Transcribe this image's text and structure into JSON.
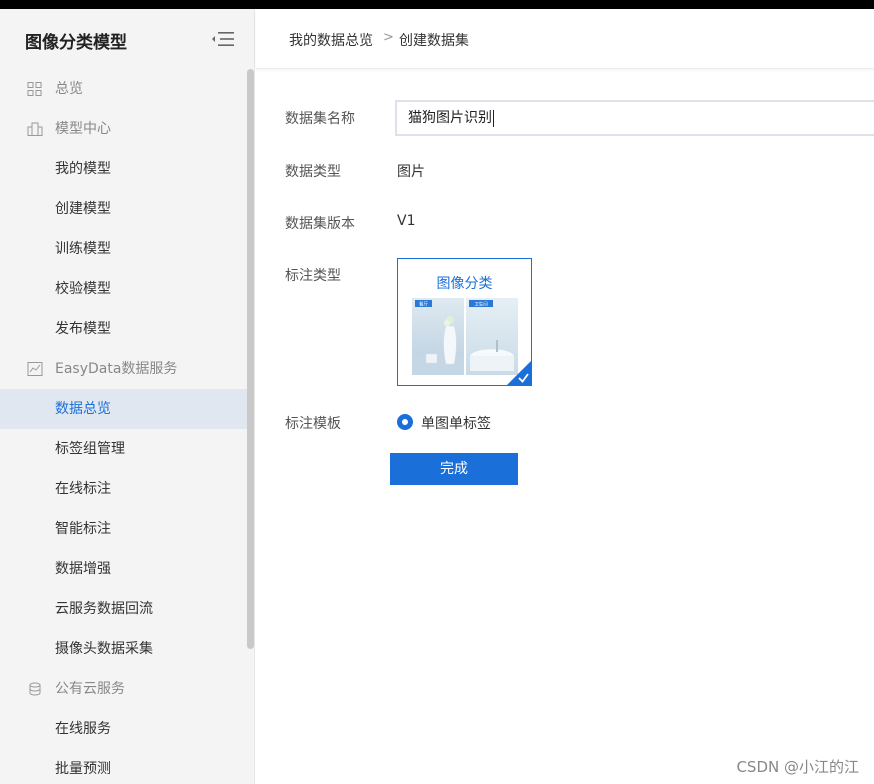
{
  "sidebar": {
    "title": "图像分类模型",
    "groups": [
      {
        "label": "总览",
        "icon": "grid-icon"
      },
      {
        "label": "模型中心",
        "icon": "model-icon",
        "items": [
          "我的模型",
          "创建模型",
          "训练模型",
          "校验模型",
          "发布模型"
        ]
      },
      {
        "label": "EasyData数据服务",
        "icon": "chart-icon",
        "items": [
          "数据总览",
          "标签组管理",
          "在线标注",
          "智能标注",
          "数据增强",
          "云服务数据回流",
          "摄像头数据采集"
        ]
      },
      {
        "label": "公有云服务",
        "icon": "database-icon",
        "items": [
          "在线服务",
          "批量预测"
        ]
      }
    ],
    "active_item": "数据总览"
  },
  "breadcrumb": {
    "item1": "我的数据总览",
    "separator": ">",
    "item2": "创建数据集"
  },
  "form": {
    "name_label": "数据集名称",
    "name_value": "猫狗图片识别",
    "type_label": "数据类型",
    "type_value": "图片",
    "version_label": "数据集版本",
    "version_value": "V1",
    "annotation_type_label": "标注类型",
    "annotation_card": {
      "title": "图像分类",
      "tag_left": "餐厅",
      "tag_right": "卫生间",
      "selected": true
    },
    "template_label": "标注模板",
    "template_option": "单图单标签",
    "submit_label": "完成"
  },
  "colors": {
    "accent": "#1a6fd8",
    "sidebar_bg": "#f4f4f5",
    "active_bg": "#e1e7f1"
  },
  "watermark": "CSDN @小江的江"
}
